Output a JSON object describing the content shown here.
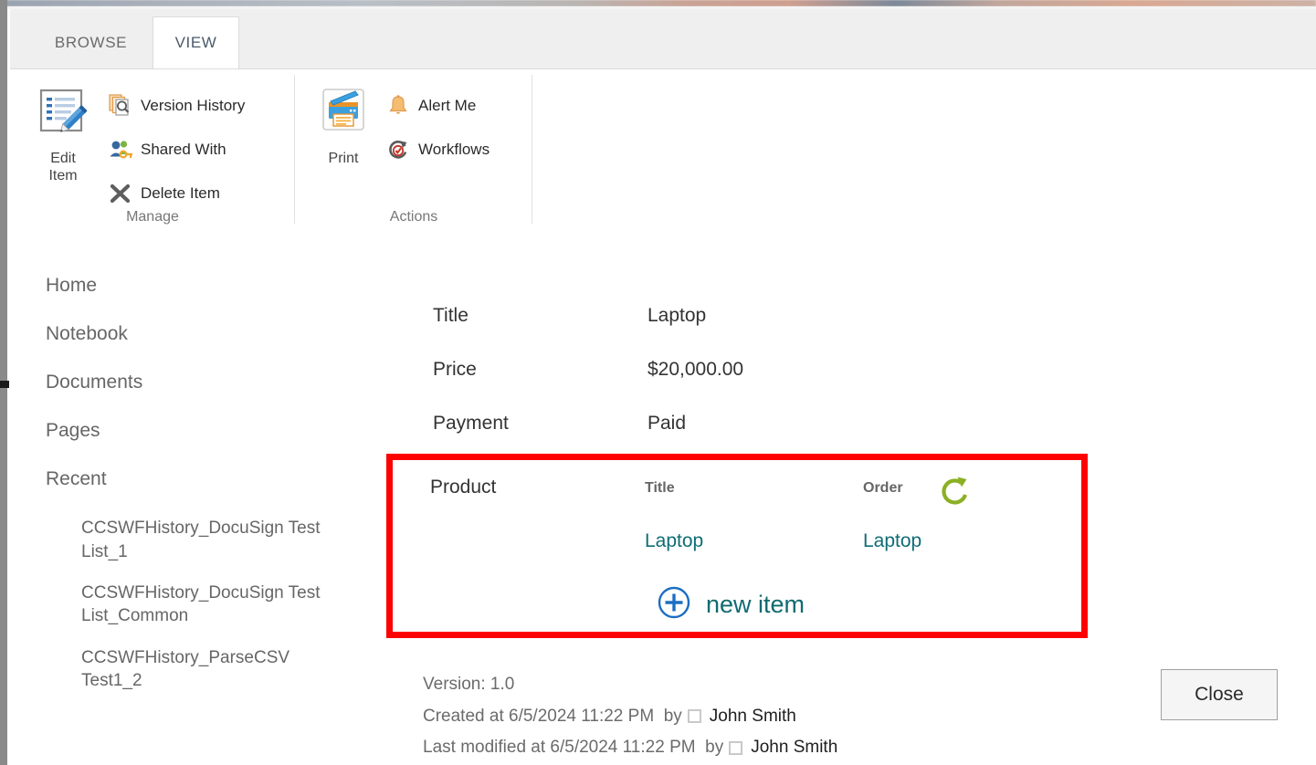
{
  "ribbon": {
    "tabs": [
      {
        "id": "browse",
        "label": "BROWSE",
        "active": false
      },
      {
        "id": "view",
        "label": "VIEW",
        "active": true
      }
    ],
    "groups": [
      {
        "id": "manage",
        "label": "Manage",
        "big_button": {
          "label_line1": "Edit",
          "label_line2": "Item",
          "icon": "edit-item-icon"
        },
        "small_buttons": [
          {
            "label": "Version History",
            "icon": "version-history-icon"
          },
          {
            "label": "Shared With",
            "icon": "shared-with-icon"
          },
          {
            "label": "Delete Item",
            "icon": "delete-item-icon"
          }
        ]
      },
      {
        "id": "actions",
        "label": "Actions",
        "big_button": {
          "label_line1": "Print",
          "label_line2": "",
          "icon": "print-icon"
        },
        "small_buttons": [
          {
            "label": "Alert Me",
            "icon": "alert-me-icon"
          },
          {
            "label": "Workflows",
            "icon": "workflows-icon"
          }
        ]
      }
    ]
  },
  "left_nav": {
    "items": [
      {
        "label": "Home"
      },
      {
        "label": "Notebook"
      },
      {
        "label": "Documents"
      },
      {
        "label": "Pages"
      },
      {
        "label": "Recent"
      }
    ],
    "recent_items": [
      {
        "label": "CCSWFHistory_DocuSign Test List_1"
      },
      {
        "label": "CCSWFHistory_DocuSign Test List_Common"
      },
      {
        "label": "CCSWFHistory_ParseCSV Test1_2"
      }
    ]
  },
  "form": {
    "fields": [
      {
        "label": "Title",
        "value": "Laptop"
      },
      {
        "label": "Price",
        "value": "$20,000.00"
      },
      {
        "label": "Payment",
        "value": "Paid"
      }
    ],
    "product": {
      "label": "Product",
      "columns": [
        {
          "label": "Title"
        },
        {
          "label": "Order"
        }
      ],
      "rows": [
        {
          "title": "Laptop",
          "order": "Laptop"
        }
      ],
      "refresh_icon": "refresh-icon",
      "new_item_label": "new item",
      "new_item_icon": "plus-circle-icon"
    }
  },
  "meta": {
    "version_line": "Version: 1.0",
    "created_prefix": "Created at 6/5/2024 11:22 PM",
    "created_by_word": "by",
    "created_by": "John Smith",
    "modified_prefix": "Last modified at 6/5/2024 11:22 PM",
    "modified_by_word": "by",
    "modified_by": "John Smith"
  },
  "footer": {
    "close_label": "Close"
  },
  "colors": {
    "highlight_border": "#ff0000",
    "link": "#0f6c75",
    "new_item_text": "#106a70",
    "refresh_green": "#8cb024",
    "plus_blue": "#1b6ec2",
    "ribbon_tab_bg": "#efefef"
  }
}
